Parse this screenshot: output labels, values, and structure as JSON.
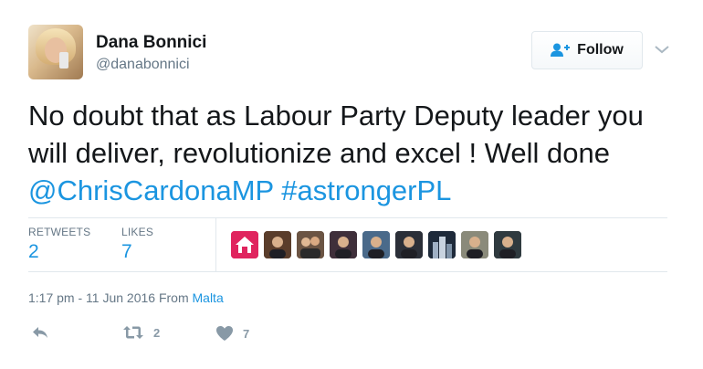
{
  "user": {
    "name": "Dana Bonnici",
    "handle": "@danabonnici"
  },
  "follow_button": {
    "label": "Follow"
  },
  "tweet": {
    "text_plain": "No doubt that as Labour Party Deputy leader you will deliver, revolutionize and excel ! Well done ",
    "mention": "@ChrisCardonaMP",
    "hashtag": "#astrongerPL"
  },
  "stats": {
    "retweets_label": "RETWEETS",
    "retweets_count": "2",
    "likes_label": "LIKES",
    "likes_count": "7"
  },
  "likers": [
    {
      "icon": "home-logo-avatar",
      "color": "#e0245e"
    },
    {
      "icon": "person-avatar",
      "color": "#5a3d2b"
    },
    {
      "icon": "couple-avatar",
      "color": "#6b5443"
    },
    {
      "icon": "person-avatar",
      "color": "#3f2f3a"
    },
    {
      "icon": "person-avatar",
      "color": "#4a6a8a"
    },
    {
      "icon": "person-avatar",
      "color": "#2b2f38"
    },
    {
      "icon": "building-avatar",
      "color": "#1e2a3a"
    },
    {
      "icon": "person-avatar",
      "color": "#8a8a7a"
    },
    {
      "icon": "person-avatar",
      "color": "#2f3a3f"
    }
  ],
  "meta": {
    "timestamp": "1:17 pm - 11 Jun 2016 From ",
    "location": "Malta"
  },
  "actions": {
    "retweet_count": "2",
    "like_count": "7"
  },
  "colors": {
    "link": "#1b95e0",
    "text": "#14171a",
    "muted": "#657786",
    "border": "#e1e8ed"
  }
}
